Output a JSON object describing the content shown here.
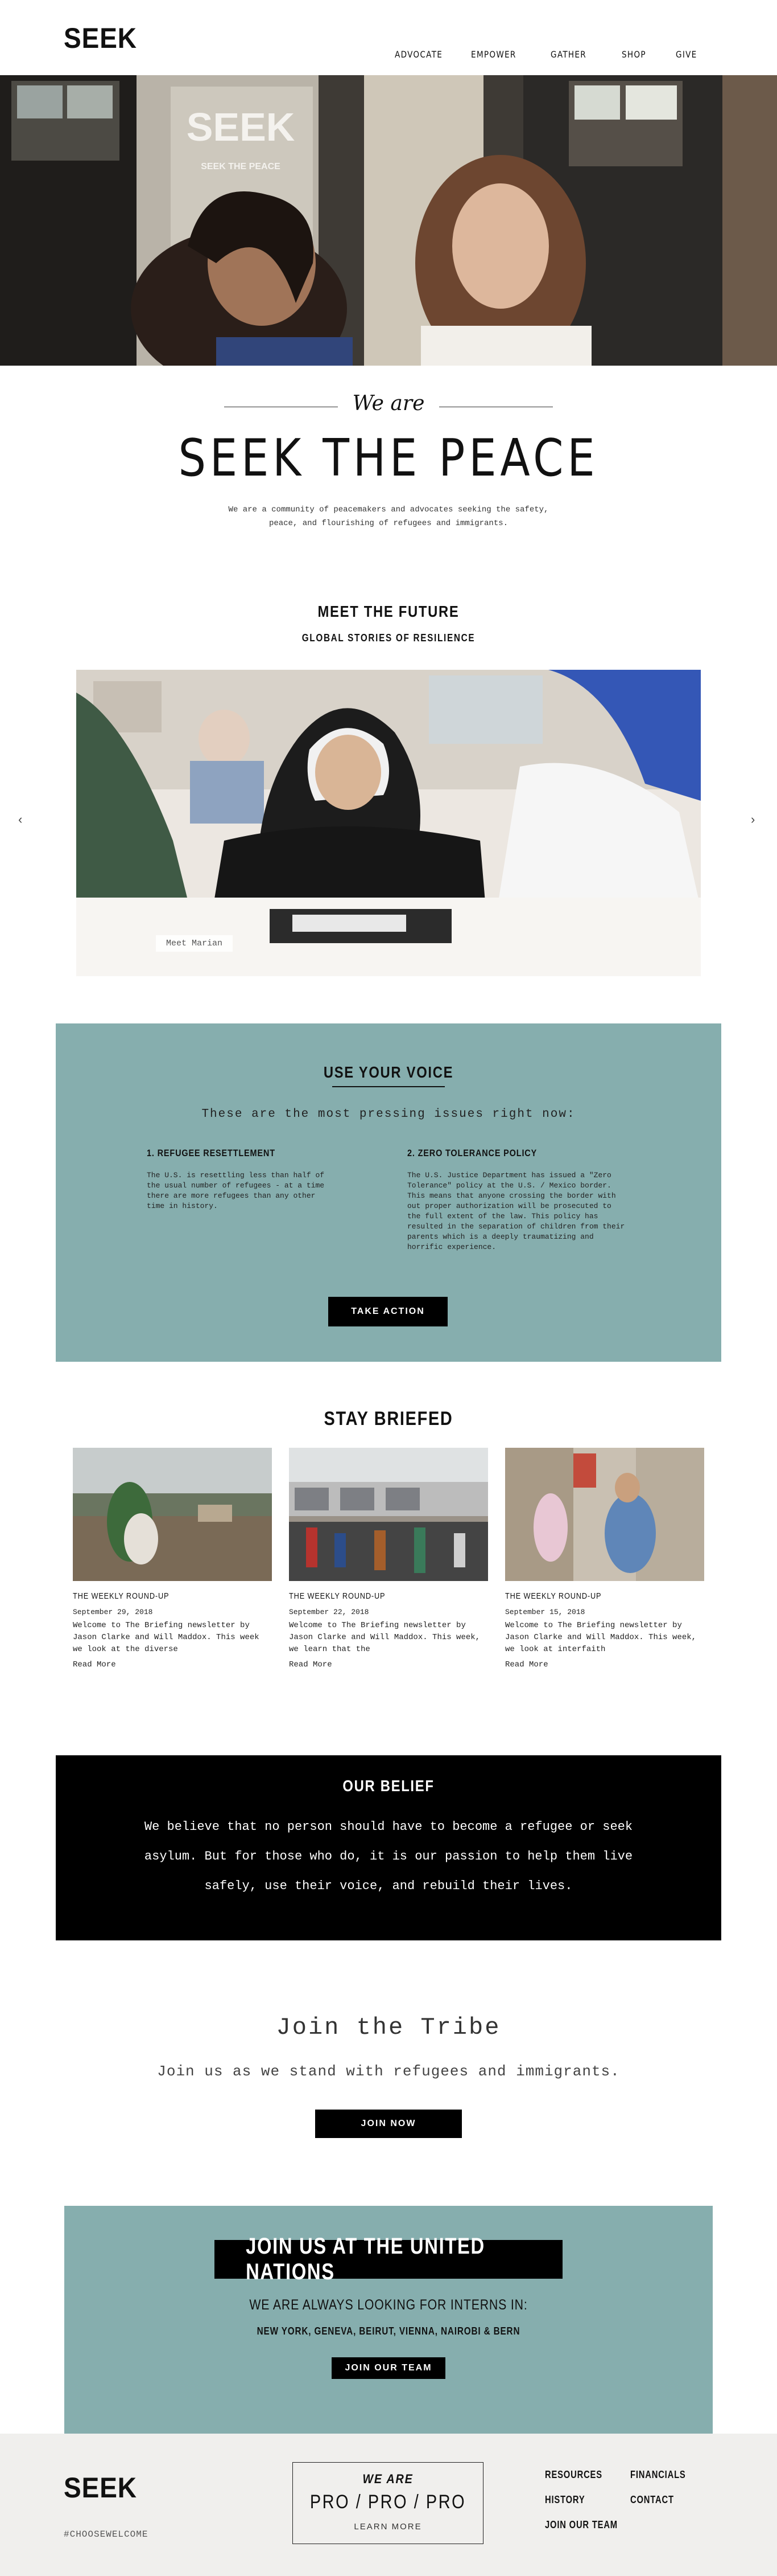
{
  "header": {
    "logo": "SEEK",
    "nav": [
      "ADVOCATE",
      "EMPOWER",
      "GATHER",
      "SHOP",
      "GIVE"
    ]
  },
  "hero": {
    "sign_text": "SEEK",
    "sign_subtext": "SEEK THE PEACE"
  },
  "intro": {
    "subtitle": "We are",
    "title": "SEEK THE PEACE",
    "description": "We are a community of peacemakers and advocates seeking the safety, peace, and flourishing of refugees and immigrants."
  },
  "meet": {
    "title": "MEET THE FUTURE",
    "subtitle": "GLOBAL STORIES OF RESILIENCE",
    "slide_caption": "Meet Marian",
    "prev_arrow": "‹",
    "next_arrow": "›"
  },
  "voice": {
    "title": "USE YOUR VOICE",
    "lead": "These are the most pressing issues right now:",
    "issues": [
      {
        "heading": "1. REFUGEE RESETTLEMENT",
        "text": "The U.S. is resettling less than half of the usual number of refugees - at a time there are more refugees than any other time in history."
      },
      {
        "heading": "2. ZERO TOLERANCE POLICY",
        "text": "The U.S. Justice Department has issued a \"Zero Tolerance\" policy at the U.S. / Mexico border. This means that anyone crossing the border with out proper authorization will be prosecuted to the full extent of the law. This policy has resulted in the separation of children from their parents which is a deeply traumatizing and horrific experience."
      }
    ],
    "button": "TAKE ACTION"
  },
  "briefed": {
    "title": "STAY BRIEFED",
    "cards": [
      {
        "tag": "THE WEEKLY ROUND-UP",
        "date": "September 29, 2018",
        "text": "Welcome to The Briefing newsletter by Jason Clarke and Will Maddox. This week we look at the diverse",
        "more": "Read More"
      },
      {
        "tag": "THE WEEKLY ROUND-UP",
        "date": "September 22, 2018",
        "text": "Welcome to The Briefing newsletter by Jason Clarke and Will Maddox. This week, we learn that the",
        "more": "Read More"
      },
      {
        "tag": "THE WEEKLY ROUND-UP",
        "date": "September 15, 2018",
        "text": "Welcome to The Briefing newsletter by Jason Clarke and Will Maddox. This week, we look at interfaith",
        "more": "Read More"
      }
    ]
  },
  "belief": {
    "title": "OUR BELIEF",
    "text": "We believe that no person should have to become a refugee or seek asylum. But for those who do, it is our passion to help them live safely, use their voice, and rebuild their lives."
  },
  "tribe": {
    "title": "Join the Tribe",
    "subtitle": "Join us as we stand with refugees and immigrants.",
    "button": "JOIN NOW"
  },
  "un": {
    "title": "JOIN US AT THE UNITED NATIONS",
    "subtitle": "WE ARE ALWAYS LOOKING FOR INTERNS IN:",
    "cities": "NEW YORK, GENEVA, BEIRUT, VIENNA, NAIROBI & BERN",
    "button": "JOIN OUR TEAM"
  },
  "footer": {
    "logo": "SEEK",
    "hashtag": "#CHOOSEWELCOME",
    "box_line1": "WE ARE",
    "box_line2": "PRO / PRO / PRO",
    "box_line3": "LEARN MORE",
    "links": [
      "RESOURCES",
      "FINANCIALS",
      "HISTORY",
      "CONTACT",
      "JOIN OUR TEAM"
    ]
  }
}
